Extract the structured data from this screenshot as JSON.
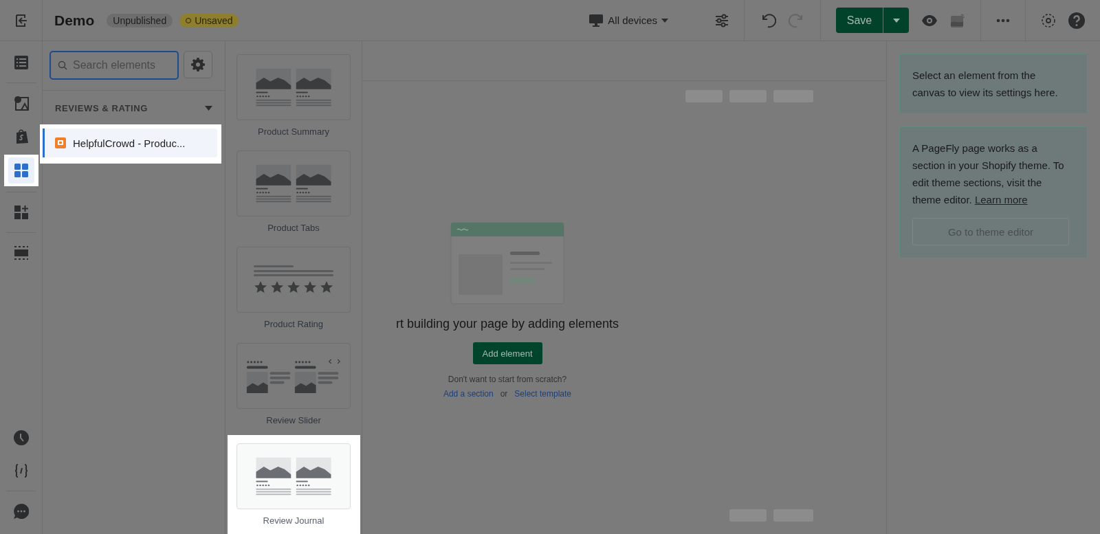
{
  "header": {
    "title": "Demo",
    "badges": [
      {
        "label": "Unpublished",
        "kind": "plain"
      },
      {
        "label": "Unsaved",
        "kind": "warning"
      }
    ],
    "device": "All devices",
    "save": "Save"
  },
  "rail": [
    {
      "selected": false,
      "highlighted": false
    },
    {
      "selected": false,
      "highlighted": false
    },
    {
      "selected": false,
      "highlighted": false
    },
    {
      "selected": true,
      "highlighted": true
    },
    {
      "selected": false,
      "highlighted": false
    },
    {
      "selected": false,
      "highlighted": false
    },
    {
      "selected": false,
      "highlighted": false
    },
    {
      "selected": false,
      "highlighted": false
    },
    {
      "selected": false,
      "highlighted": false
    }
  ],
  "search": {
    "placeholder": "Search elements"
  },
  "category": {
    "label": "REVIEWS & RATING",
    "expanded": true
  },
  "elements": [
    {
      "label": "HelpfulCrowd - Produc...",
      "selected": true,
      "highlighted": true
    }
  ],
  "widgets": [
    {
      "label": "Product Summary",
      "kind": "summary",
      "highlighted": false
    },
    {
      "label": "Product Tabs",
      "kind": "summary",
      "highlighted": false
    },
    {
      "label": "Product Rating",
      "kind": "rating",
      "highlighted": false
    },
    {
      "label": "Review Slider",
      "kind": "slider",
      "highlighted": false
    },
    {
      "label": "Review Journal",
      "kind": "summary",
      "highlighted": true
    }
  ],
  "canvas": {
    "headline": "rt building your page by adding elements",
    "button": "Add element",
    "prompt": "Don't want to start from scratch?",
    "links": [
      "Add a section",
      "Select template"
    ],
    "separator": "or"
  },
  "notices": [
    {
      "text": "Select an element from the canvas to view its settings here."
    },
    {
      "text": "A PageFly page works as a section in your Shopify theme. To edit theme sections, visit the theme editor.",
      "link": "Learn more",
      "button": "Go to theme editor"
    }
  ]
}
